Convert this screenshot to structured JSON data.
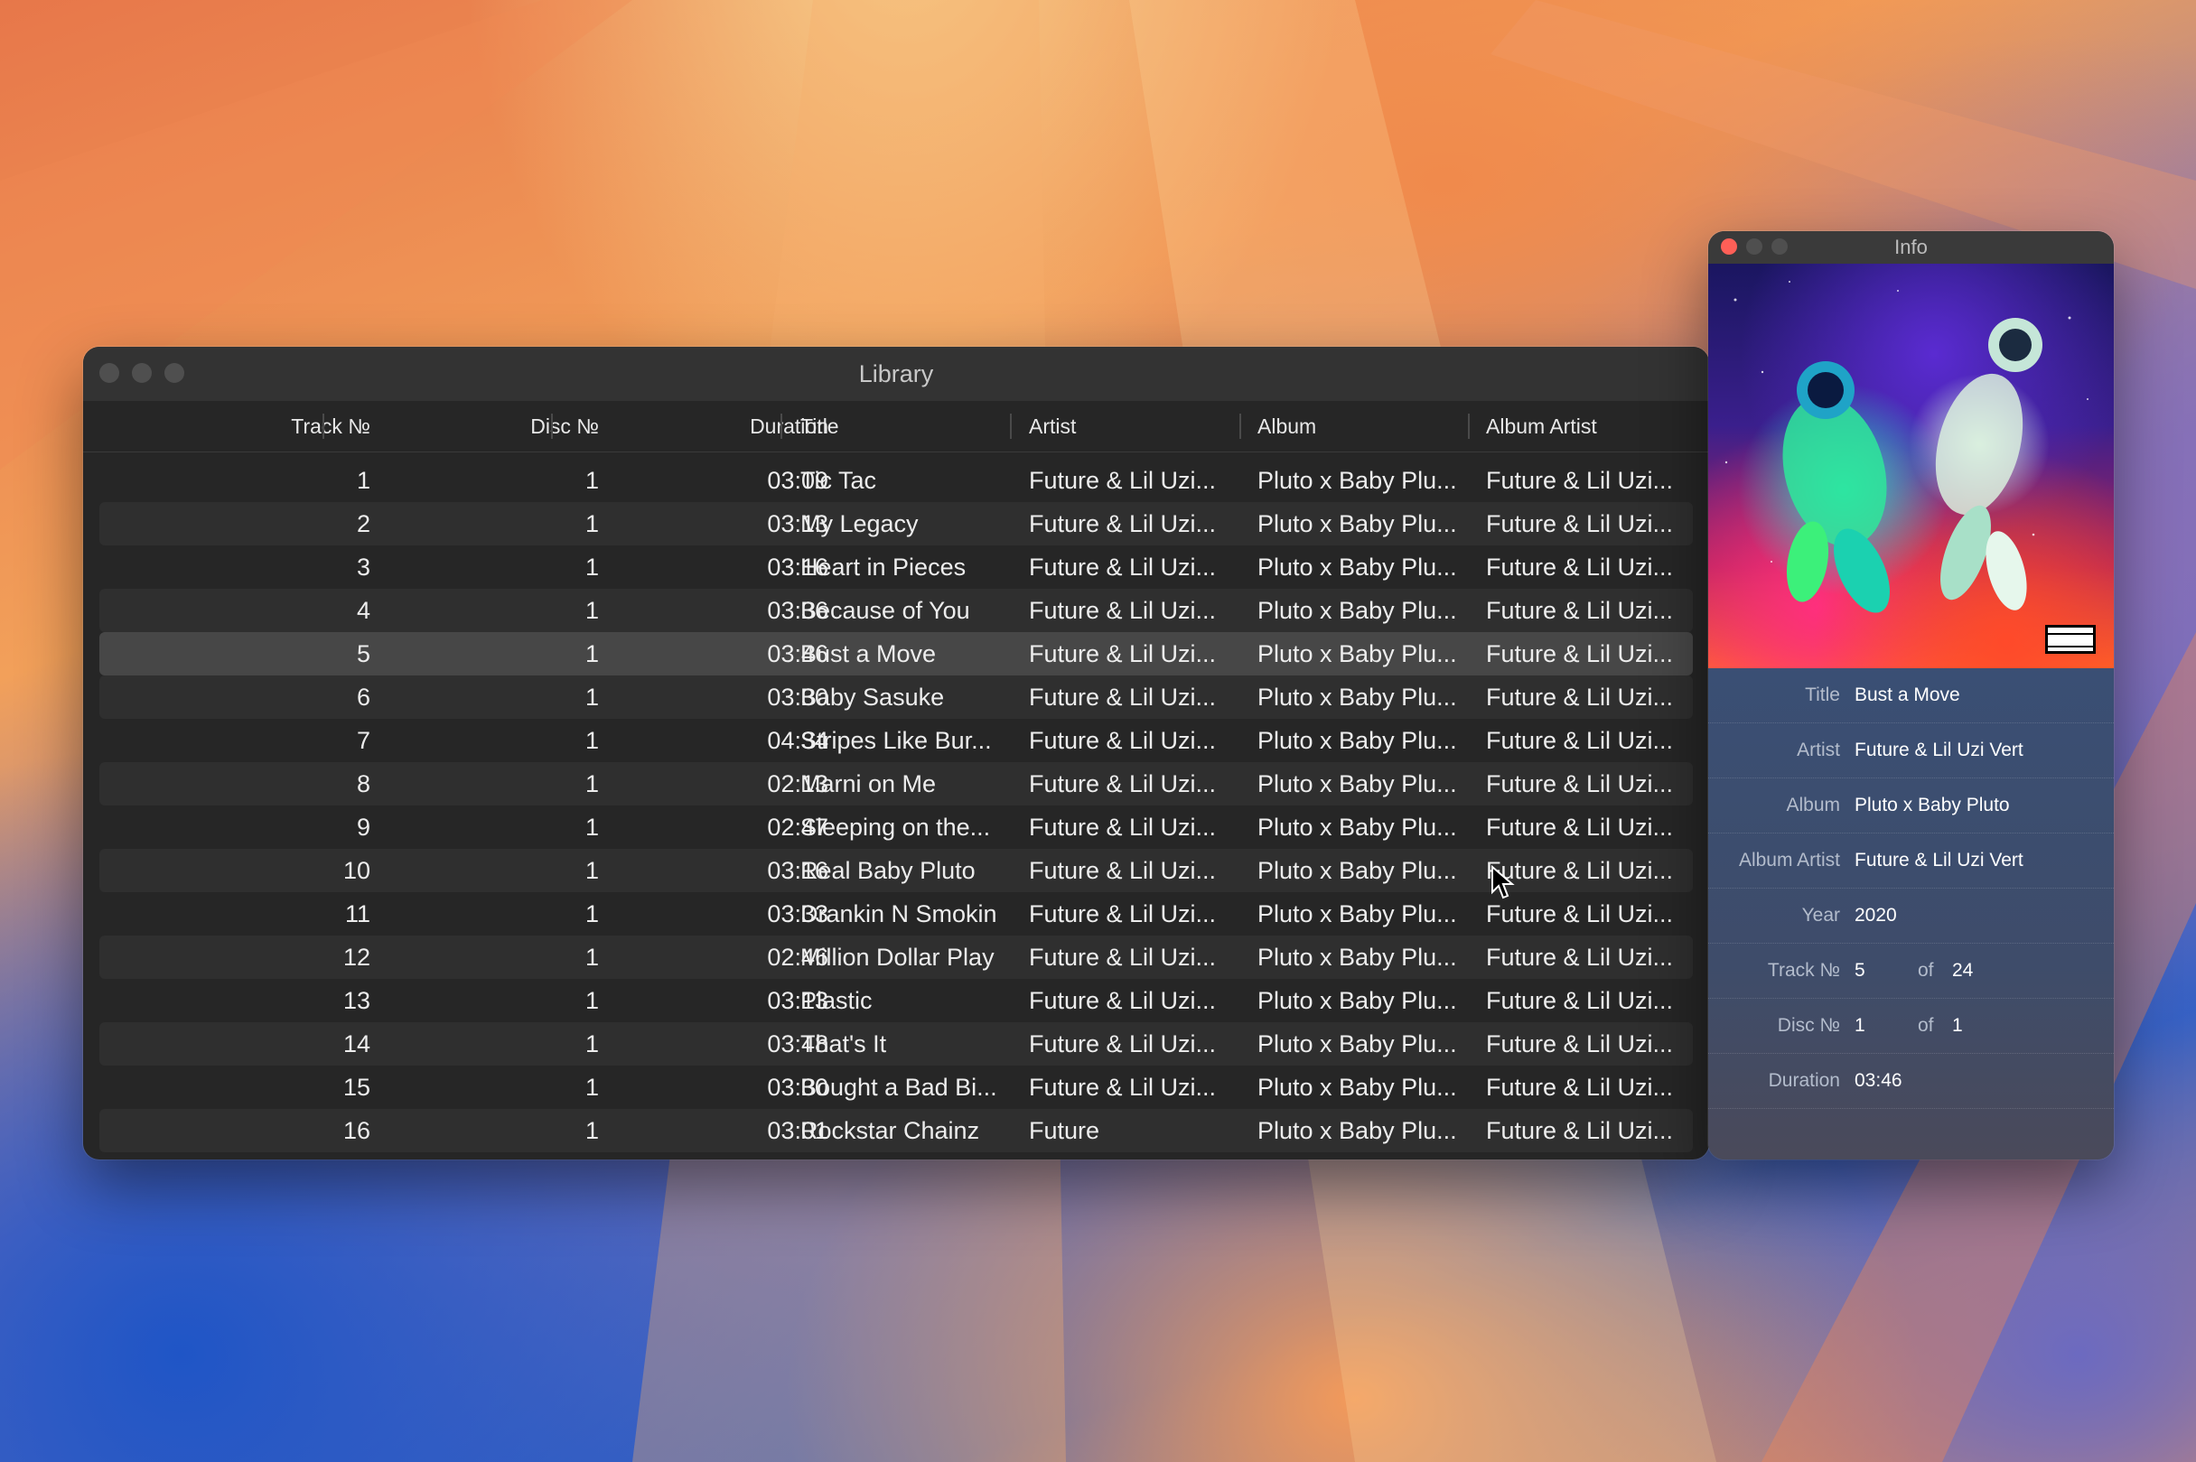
{
  "library": {
    "title": "Library",
    "columns": [
      "Track №",
      "Disc №",
      "Duration",
      "Title",
      "Artist",
      "Album",
      "Album Artist"
    ],
    "selected_index": 4,
    "rows": [
      {
        "track": "1",
        "disc": "1",
        "duration": "03:09",
        "title": "Tic Tac",
        "artist": "Future & Lil Uzi...",
        "album": "Pluto x Baby Plu...",
        "album_artist": "Future & Lil Uzi..."
      },
      {
        "track": "2",
        "disc": "1",
        "duration": "03:13",
        "title": "My Legacy",
        "artist": "Future & Lil Uzi...",
        "album": "Pluto x Baby Plu...",
        "album_artist": "Future & Lil Uzi..."
      },
      {
        "track": "3",
        "disc": "1",
        "duration": "03:16",
        "title": "Heart in Pieces",
        "artist": "Future & Lil Uzi...",
        "album": "Pluto x Baby Plu...",
        "album_artist": "Future & Lil Uzi..."
      },
      {
        "track": "4",
        "disc": "1",
        "duration": "03:36",
        "title": "Because of You",
        "artist": "Future & Lil Uzi...",
        "album": "Pluto x Baby Plu...",
        "album_artist": "Future & Lil Uzi..."
      },
      {
        "track": "5",
        "disc": "1",
        "duration": "03:46",
        "title": "Bust a Move",
        "artist": "Future & Lil Uzi...",
        "album": "Pluto x Baby Plu...",
        "album_artist": "Future & Lil Uzi..."
      },
      {
        "track": "6",
        "disc": "1",
        "duration": "03:30",
        "title": "Baby Sasuke",
        "artist": "Future & Lil Uzi...",
        "album": "Pluto x Baby Plu...",
        "album_artist": "Future & Lil Uzi..."
      },
      {
        "track": "7",
        "disc": "1",
        "duration": "04:34",
        "title": "Stripes Like Bur...",
        "artist": "Future & Lil Uzi...",
        "album": "Pluto x Baby Plu...",
        "album_artist": "Future & Lil Uzi..."
      },
      {
        "track": "8",
        "disc": "1",
        "duration": "02:13",
        "title": "Marni on Me",
        "artist": "Future & Lil Uzi...",
        "album": "Pluto x Baby Plu...",
        "album_artist": "Future & Lil Uzi..."
      },
      {
        "track": "9",
        "disc": "1",
        "duration": "02:47",
        "title": "Sleeping on the...",
        "artist": "Future & Lil Uzi...",
        "album": "Pluto x Baby Plu...",
        "album_artist": "Future & Lil Uzi..."
      },
      {
        "track": "10",
        "disc": "1",
        "duration": "03:16",
        "title": "Real Baby Pluto",
        "artist": "Future & Lil Uzi...",
        "album": "Pluto x Baby Plu...",
        "album_artist": "Future & Lil Uzi..."
      },
      {
        "track": "11",
        "disc": "1",
        "duration": "03:33",
        "title": "Drankin N Smokin",
        "artist": "Future & Lil Uzi...",
        "album": "Pluto x Baby Plu...",
        "album_artist": "Future & Lil Uzi..."
      },
      {
        "track": "12",
        "disc": "1",
        "duration": "02:46",
        "title": "Million Dollar Play",
        "artist": "Future & Lil Uzi...",
        "album": "Pluto x Baby Plu...",
        "album_artist": "Future & Lil Uzi..."
      },
      {
        "track": "13",
        "disc": "1",
        "duration": "03:13",
        "title": "Plastic",
        "artist": "Future & Lil Uzi...",
        "album": "Pluto x Baby Plu...",
        "album_artist": "Future & Lil Uzi..."
      },
      {
        "track": "14",
        "disc": "1",
        "duration": "03:48",
        "title": "That's It",
        "artist": "Future & Lil Uzi...",
        "album": "Pluto x Baby Plu...",
        "album_artist": "Future & Lil Uzi..."
      },
      {
        "track": "15",
        "disc": "1",
        "duration": "03:30",
        "title": "Bought a Bad Bi...",
        "artist": "Future & Lil Uzi...",
        "album": "Pluto x Baby Plu...",
        "album_artist": "Future & Lil Uzi..."
      },
      {
        "track": "16",
        "disc": "1",
        "duration": "03:01",
        "title": "Rockstar Chainz",
        "artist": "Future",
        "album": "Pluto x Baby Plu...",
        "album_artist": "Future & Lil Uzi..."
      }
    ]
  },
  "info": {
    "title": "Info",
    "art_badge": "PARENTAL ADVISORY EXPLICIT CONTENT",
    "fields": [
      {
        "label": "Title",
        "value": "Bust a Move"
      },
      {
        "label": "Artist",
        "value": "Future & Lil Uzi Vert"
      },
      {
        "label": "Album",
        "value": "Pluto x Baby Pluto"
      },
      {
        "label": "Album Artist",
        "value": "Future & Lil Uzi Vert"
      },
      {
        "label": "Year",
        "value": "2020"
      },
      {
        "label": "Track №",
        "value": "5",
        "of_label": "of",
        "total": "24"
      },
      {
        "label": "Disc №",
        "value": "1",
        "of_label": "of",
        "total": "1"
      },
      {
        "label": "Duration",
        "value": "03:46"
      }
    ]
  },
  "colors": {
    "window_bg": "#262626",
    "row_alt": "#2f2f2f",
    "row_selected": "#474747",
    "close_red": "#fe5f57",
    "info_panel": "#3b4b6c"
  }
}
